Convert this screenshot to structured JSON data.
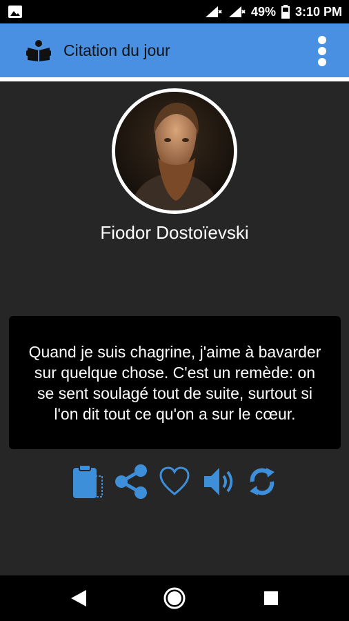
{
  "status_bar": {
    "battery": "49%",
    "time": "3:10 PM"
  },
  "app_bar": {
    "title": "Citation du jour"
  },
  "author": {
    "name": "Fiodor Dostoïevski"
  },
  "quote": {
    "text": "Quand je suis chagrine, j'aime à bavarder sur quelque chose. C'est un remède: on se sent soulagé tout de suite, surtout si l'on dit tout ce qu'on a sur le cœur."
  },
  "actions": [
    "clipboard-icon",
    "share-icon",
    "heart-icon",
    "speaker-icon",
    "refresh-icon"
  ],
  "colors": {
    "app_bar": "#4a90e2",
    "icon_accent": "#3d8fd9",
    "background": "#262626"
  }
}
